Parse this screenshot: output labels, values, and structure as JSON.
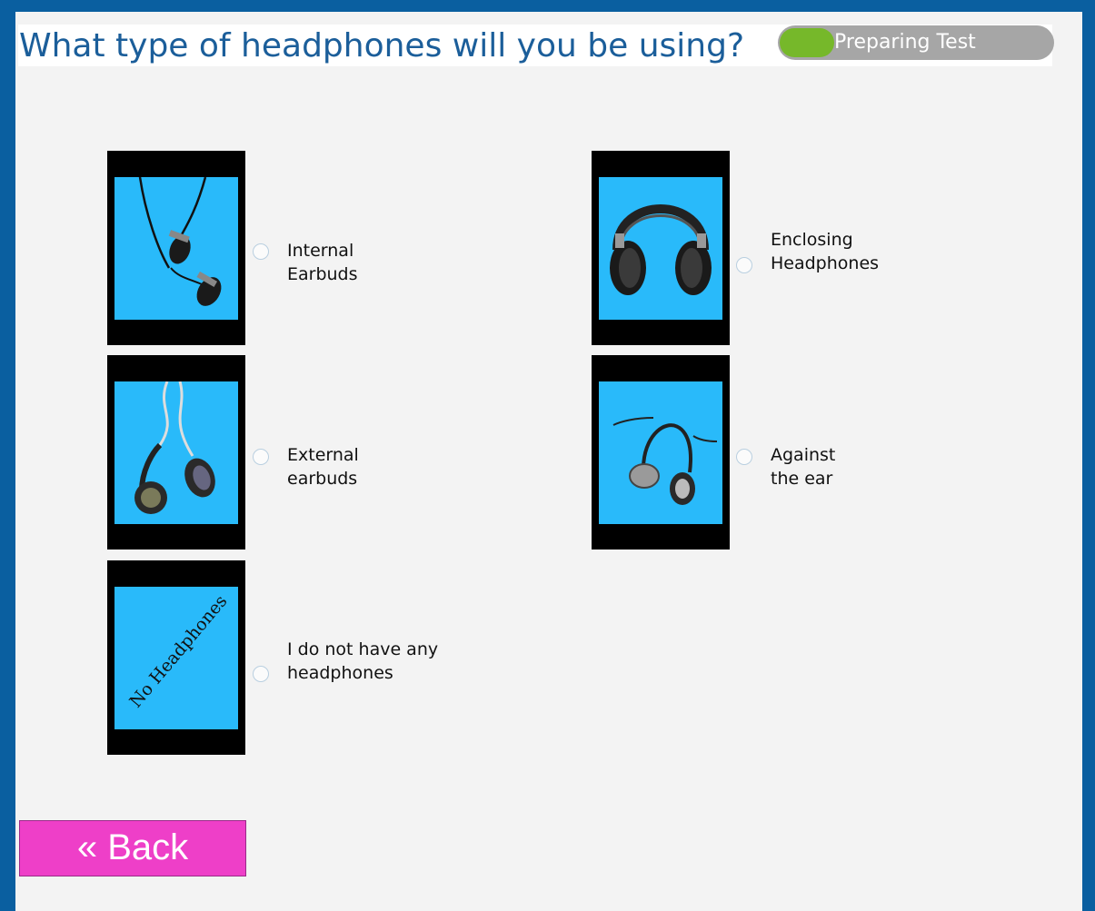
{
  "page": {
    "title": "What type of headphones will you be using?",
    "progress": {
      "label": "Preparing Test",
      "fraction": 0.2
    }
  },
  "options": [
    {
      "label": "Internal Earbuds",
      "icon": "internal-earbuds-image",
      "selected": false
    },
    {
      "label": "Enclosing Headphones",
      "icon": "enclosing-headphones-image",
      "selected": false
    },
    {
      "label": "External earbuds",
      "icon": "external-earbuds-image",
      "selected": false
    },
    {
      "label": "Against the ear",
      "icon": "against-the-ear-image",
      "selected": false
    },
    {
      "label": "I do not have any headphones",
      "icon": "no-headphones-image",
      "image_text": "No Headphones",
      "selected": false
    }
  ],
  "nav": {
    "back_label": "« Back"
  },
  "colors": {
    "frame": "#0a5fa0",
    "title": "#1b5e9a",
    "progress_fill": "#76b82a",
    "progress_track": "#a6a6a6",
    "thumb_background": "#29bafa",
    "back_button": "#ee3fc8"
  }
}
